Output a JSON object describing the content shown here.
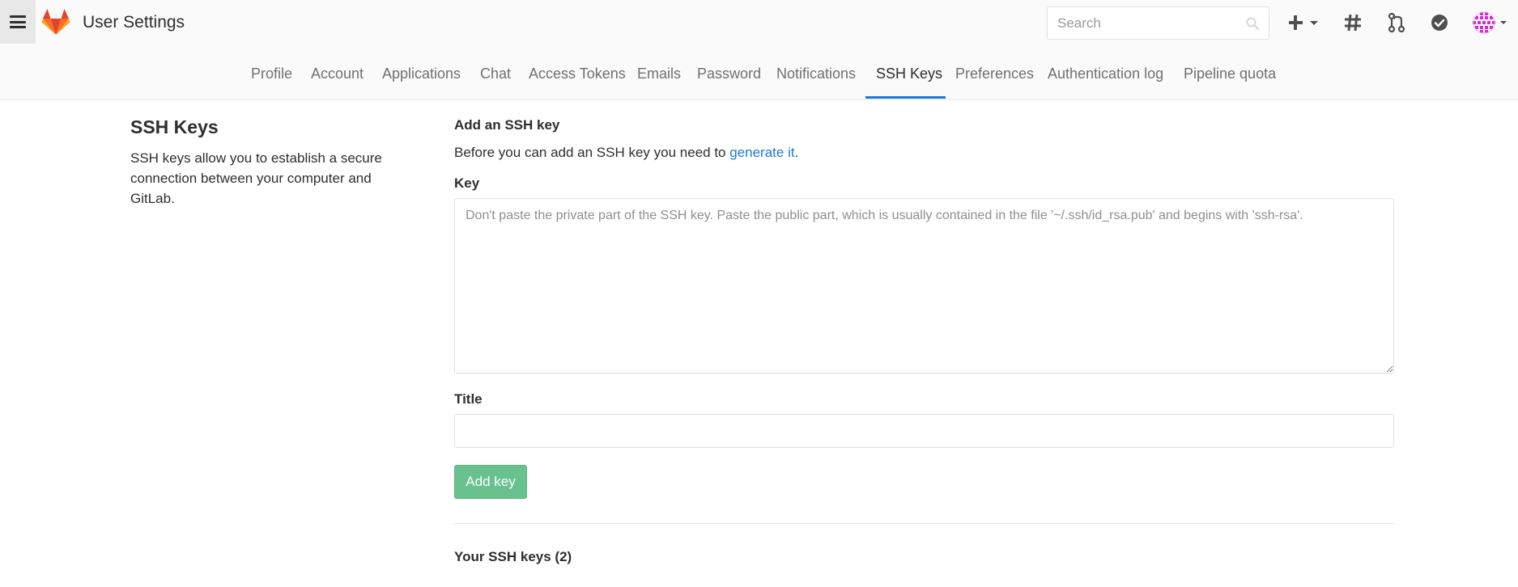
{
  "header": {
    "title": "User Settings",
    "search_placeholder": "Search",
    "icons": {
      "menu": "hamburger-icon",
      "logo": "gitlab-tanuki-logo",
      "search": "search-icon",
      "new": "plus-icon",
      "issues": "hash-icon",
      "merge_requests": "merge-request-icon",
      "todos": "todo-check-icon",
      "avatar": "avatar"
    }
  },
  "tabs": [
    {
      "label": "Profile"
    },
    {
      "label": "Account"
    },
    {
      "label": "Applications"
    },
    {
      "label": "Chat"
    },
    {
      "label": "Access Tokens"
    },
    {
      "label": "Emails"
    },
    {
      "label": "Password"
    },
    {
      "label": "Notifications"
    },
    {
      "label": "SSH Keys",
      "active": true
    },
    {
      "label": "Preferences"
    },
    {
      "label": "Authentication log"
    },
    {
      "label": "Pipeline quota"
    }
  ],
  "sidebar": {
    "title": "SSH Keys",
    "description": "SSH keys allow you to establish a secure connection between your computer and GitLab."
  },
  "form": {
    "section_title": "Add an SSH key",
    "intro_text": "Before you can add an SSH key you need to ",
    "intro_link": "generate it",
    "intro_end": ".",
    "key_label": "Key",
    "key_placeholder": "Don't paste the private part of the SSH key. Paste the public part, which is usually contained in the file '~/.ssh/id_rsa.pub' and begins with 'ssh-rsa'.",
    "title_label": "Title",
    "title_value": "",
    "submit_label": "Add key"
  },
  "keys_list": {
    "heading": "Your SSH keys (2)"
  },
  "colors": {
    "accent": "#1f78d1",
    "button_green": "#69c28e",
    "logo_orange": "#fc6d26",
    "logo_red": "#e24329",
    "logo_light": "#fca326",
    "avatar_magenta": "#d12bd6"
  }
}
